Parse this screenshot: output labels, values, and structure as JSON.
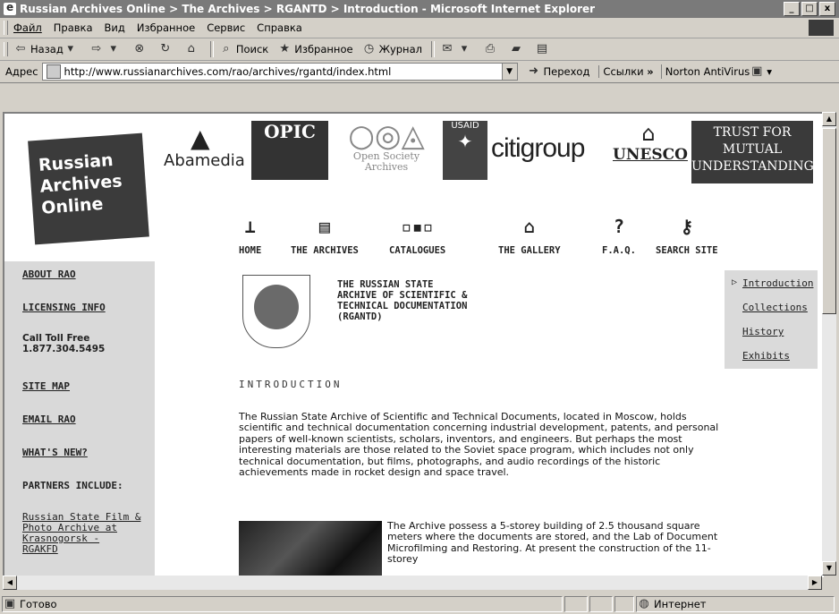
{
  "window": {
    "title": "Russian Archives Online > The Archives > RGANTD > Introduction - Microsoft Internet Explorer",
    "min": "_",
    "max": "□",
    "close": "x"
  },
  "menu": [
    "Файл",
    "Правка",
    "Вид",
    "Избранное",
    "Сервис",
    "Справка"
  ],
  "toolbar": {
    "back": "Назад",
    "search": "Поиск",
    "favorites": "Избранное",
    "history": "Журнал"
  },
  "address": {
    "label": "Адрес",
    "url": "http://www.russianarchives.com/rao/archives/rgantd/index.html",
    "go": "Переход",
    "links": "Ссылки",
    "norton": "Norton AntiVirus"
  },
  "logo": {
    "line1": "Russian",
    "line2": "Archives",
    "line3": "Online"
  },
  "partners": {
    "abamedia": "Abamedia",
    "opic": "OPIC",
    "osa1": "Open Society",
    "osa2": "Archives",
    "usaid": "USAID",
    "citigroup": "citigroup",
    "unesco": "UNESCO",
    "trust1": "Trust for",
    "trust2": "Mutual",
    "trust3": "Understanding"
  },
  "nav": [
    "HOME",
    "THE ARCHIVES",
    "CATALOGUES",
    "THE GALLERY",
    "F.A.Q.",
    "SEARCH SITE"
  ],
  "leftnav": {
    "about": "ABOUT RAO",
    "licensing": "LICENSING INFO",
    "call1": "Call Toll Free",
    "call2": "1.877.304.5495",
    "sitemap": "SITE MAP",
    "email": "EMAIL RAO",
    "whatsnew": "WHAT'S NEW?",
    "partners": "PARTNERS INCLUDE:",
    "partner_link": [
      "Russian State Film &",
      "Photo Archive at",
      "Krasnogorsk -",
      "RGAKFD"
    ]
  },
  "archive_title": "THE RUSSIAN STATE\nARCHIVE OF SCIENTIFIC &\nTECHNICAL DOCUMENTATION\n(RGANTD)",
  "subnav": [
    "Introduction",
    "Collections",
    "History",
    "Exhibits"
  ],
  "intro_heading": "INTRODUCTION",
  "body1": "The Russian State Archive of Scientific and Technical Documents, located in Moscow, holds scientific and technical documentation concerning industrial development, patents, and personal papers of well-known scientists, scholars, inventors, and engineers. But perhaps the most interesting materials are those related to the Soviet space program, which includes not only technical documentation, but films, photographs, and audio recordings of the historic achievements made in rocket design and space travel.",
  "body2": "The Archive possess a 5-storey building of 2.5 thousand square meters where the documents are stored, and the Lab of Document Microfilming and Restoring. At present the construction of the 11-storey",
  "status": {
    "ready": "Готово",
    "zone": "Интернет"
  }
}
